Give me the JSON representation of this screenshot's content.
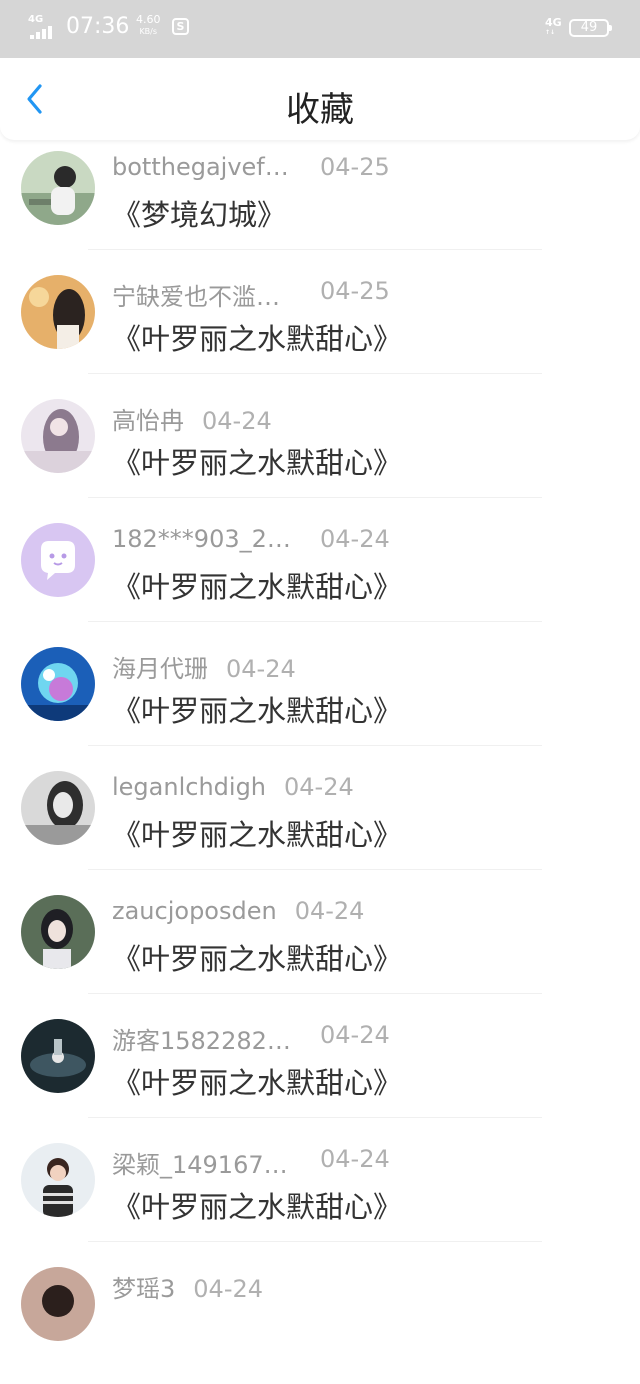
{
  "status_bar": {
    "network": "4G",
    "time": "07:36",
    "speed_value": "4.60",
    "speed_unit": "KB/s",
    "network2": "4G",
    "battery": "49"
  },
  "nav": {
    "back_icon": "chevron-left-icon",
    "title": "收藏",
    "accent_color": "#2196f3"
  },
  "favorites": [
    {
      "user": "botthegajvef…",
      "date": "04-25",
      "book": "《梦境幻城》",
      "avatar": "avatar-photo"
    },
    {
      "user": "宁缺爱也不滥…",
      "date": "04-25",
      "book": "《叶罗丽之水默甜心》",
      "avatar": "avatar-photo"
    },
    {
      "user": "高怡冉",
      "date": "04-24",
      "book": "《叶罗丽之水默甜心》",
      "avatar": "avatar-photo"
    },
    {
      "user": "182***903_2…",
      "date": "04-24",
      "book": "《叶罗丽之水默甜心》",
      "avatar": "default-avatar-icon"
    },
    {
      "user": "海月代珊",
      "date": "04-24",
      "book": "《叶罗丽之水默甜心》",
      "avatar": "avatar-photo"
    },
    {
      "user": "leganlchdigh",
      "date": "04-24",
      "book": "《叶罗丽之水默甜心》",
      "avatar": "avatar-photo"
    },
    {
      "user": "zaucjoposden",
      "date": "04-24",
      "book": "《叶罗丽之水默甜心》",
      "avatar": "avatar-photo"
    },
    {
      "user": "游客1582282…",
      "date": "04-24",
      "book": "《叶罗丽之水默甜心》",
      "avatar": "avatar-photo"
    },
    {
      "user": "梁颖_149167…",
      "date": "04-24",
      "book": "《叶罗丽之水默甜心》",
      "avatar": "avatar-photo"
    },
    {
      "user": "梦瑶3",
      "date": "04-24",
      "book": "",
      "avatar": "avatar-photo"
    }
  ]
}
